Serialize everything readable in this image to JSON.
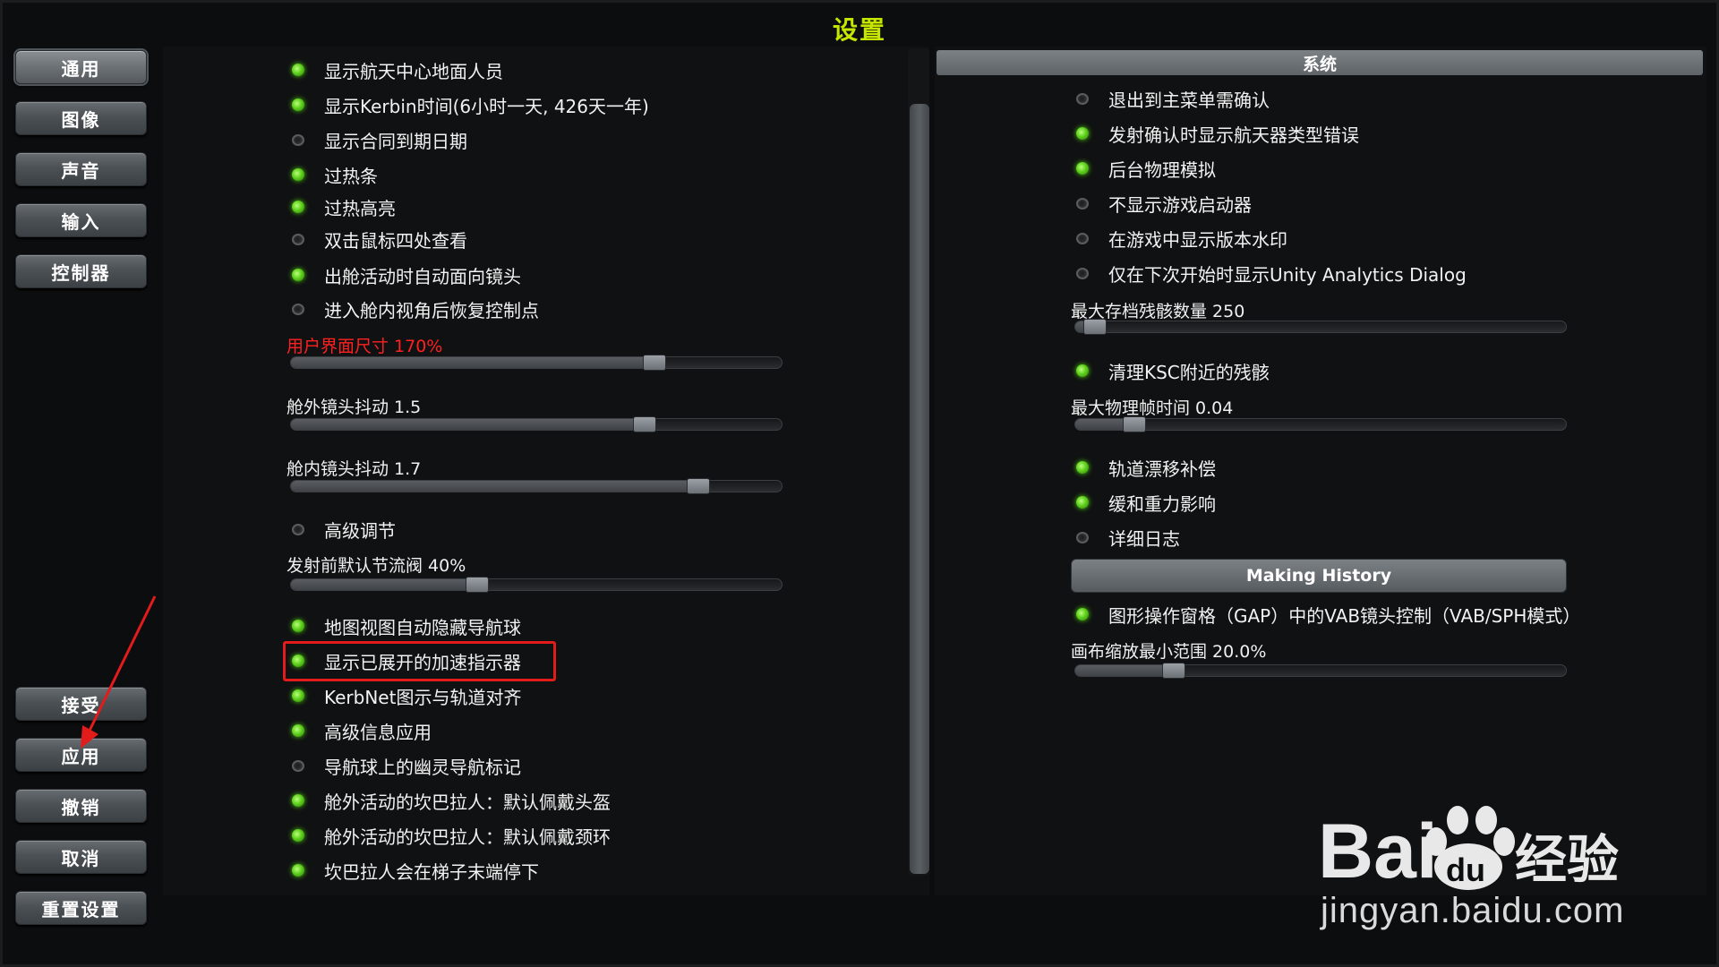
{
  "window": {
    "title": "设置"
  },
  "nav": {
    "top": [
      "通用",
      "图像",
      "声音",
      "输入",
      "控制器"
    ],
    "bottom": [
      "接受",
      "应用",
      "撤销",
      "取消",
      "重置设置"
    ]
  },
  "left": {
    "toggles_a": [
      {
        "label": "显示航天中心地面人员",
        "on": true
      },
      {
        "label": "显示Kerbin时间(6小时一天, 426天一年)",
        "on": true
      },
      {
        "label": "显示合同到期日期",
        "on": false
      },
      {
        "label": "过热条",
        "on": true
      },
      {
        "label": "过热高亮",
        "on": true
      },
      {
        "label": "双击鼠标四处查看",
        "on": false
      },
      {
        "label": "出舱活动时自动面向镜头",
        "on": true
      },
      {
        "label": "进入舱内视角后恢复控制点",
        "on": false
      }
    ],
    "sliders_a": [
      {
        "label": "用户界面尺寸 170%",
        "value": 0.74,
        "red": true
      },
      {
        "label": "舱外镜头抖动 1.5",
        "value": 0.72
      },
      {
        "label": "舱内镜头抖动 1.7",
        "value": 0.83
      }
    ],
    "advanced": {
      "label": "高级调节",
      "on": false
    },
    "throttle": {
      "label": "发射前默认节流阀 40%",
      "value": 0.38
    },
    "toggles_b": [
      {
        "label": "地图视图自动隐藏导航球",
        "on": true
      },
      {
        "label": "显示已展开的加速指示器",
        "on": true
      },
      {
        "label": "KerbNet图示与轨道对齐",
        "on": true
      },
      {
        "label": "高级信息应用",
        "on": true
      },
      {
        "label": "导航球上的幽灵导航标记",
        "on": false
      },
      {
        "label": "舱外活动的坎巴拉人：默认佩戴头盔",
        "on": true
      },
      {
        "label": "舱外活动的坎巴拉人：默认佩戴颈环",
        "on": true
      },
      {
        "label": "坎巴拉人会在梯子末端停下",
        "on": true
      }
    ]
  },
  "right": {
    "system_header": "系统",
    "toggles_a": [
      {
        "label": "退出到主菜单需确认",
        "on": false
      },
      {
        "label": "发射确认时显示航天器类型错误",
        "on": true
      },
      {
        "label": "后台物理模拟",
        "on": true
      },
      {
        "label": "不显示游戏启动器",
        "on": false
      },
      {
        "label": "在游戏中显示版本水印",
        "on": false
      },
      {
        "label": "仅在下次开始时显示Unity Analytics Dialog",
        "on": false
      }
    ],
    "debris": {
      "label": "最大存档残骸数量 250",
      "value": 0.04
    },
    "clean_ksc": {
      "label": "清理KSC附近的残骸",
      "on": true
    },
    "phys": {
      "label": "最大物理帧时间 0.04",
      "value": 0.12
    },
    "toggles_b": [
      {
        "label": "轨道漂移补偿",
        "on": true
      },
      {
        "label": "缓和重力影响",
        "on": true
      },
      {
        "label": "详细日志",
        "on": false
      }
    ],
    "making_history": "Making History",
    "gap": {
      "label": "图形操作窗格（GAP）中的VAB镜头控制（VAB/SPH模式）",
      "on": true
    },
    "canvas": {
      "label": "画布缩放最小范围 20.0%",
      "value": 0.2
    }
  },
  "watermark": {
    "logo_text": "Bai",
    "logo_text2": "经验",
    "paw_text": "du",
    "url": "jingyan.baidu.com"
  },
  "colors": {
    "title": "#c6e600",
    "toggle_on": "#5fd01d",
    "highlight": "#e21b1b"
  }
}
